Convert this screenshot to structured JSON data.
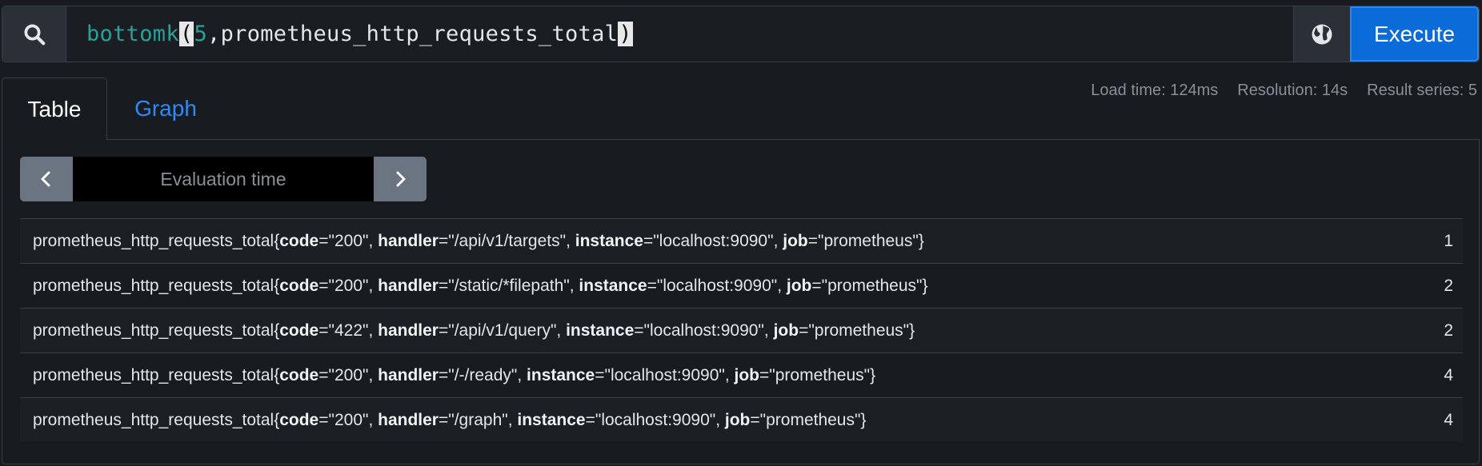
{
  "query": {
    "fn": "bottomk",
    "open_paren": "(",
    "k": "5",
    "comma": ",",
    "metric": "prometheus_http_requests_total",
    "close_paren": ")",
    "execute_label": "Execute",
    "search_icon": "search-icon",
    "explorer_icon": "globe-icon"
  },
  "tabs": [
    {
      "label": "Table"
    },
    {
      "label": "Graph"
    }
  ],
  "stats": {
    "load_time": "Load time: 124ms",
    "resolution": "Resolution: 14s",
    "result_series": "Result series: 5"
  },
  "eval": {
    "placeholder": "Evaluation time"
  },
  "results": [
    {
      "metric": "prometheus_http_requests_total",
      "code": "\"200\"",
      "handler": "\"/api/v1/targets\"",
      "instance": "\"localhost:9090\"",
      "job": "\"prometheus\"",
      "value": "1"
    },
    {
      "metric": "prometheus_http_requests_total",
      "code": "\"200\"",
      "handler": "\"/static/*filepath\"",
      "instance": "\"localhost:9090\"",
      "job": "\"prometheus\"",
      "value": "2"
    },
    {
      "metric": "prometheus_http_requests_total",
      "code": "\"422\"",
      "handler": "\"/api/v1/query\"",
      "instance": "\"localhost:9090\"",
      "job": "\"prometheus\"",
      "value": "2"
    },
    {
      "metric": "prometheus_http_requests_total",
      "code": "\"200\"",
      "handler": "\"/-/ready\"",
      "instance": "\"localhost:9090\"",
      "job": "\"prometheus\"",
      "value": "4"
    },
    {
      "metric": "prometheus_http_requests_total",
      "code": "\"200\"",
      "handler": "\"/graph\"",
      "instance": "\"localhost:9090\"",
      "job": "\"prometheus\"",
      "value": "4"
    }
  ],
  "label_names": {
    "code": "code",
    "handler": "handler",
    "instance": "instance",
    "job": "job"
  },
  "punct": {
    "open": "{",
    "eq": "=",
    "sep": ", ",
    "close": "}"
  },
  "colors": {
    "accent": "#0b6bd9",
    "link": "#2f8af5",
    "background": "#181b20"
  }
}
